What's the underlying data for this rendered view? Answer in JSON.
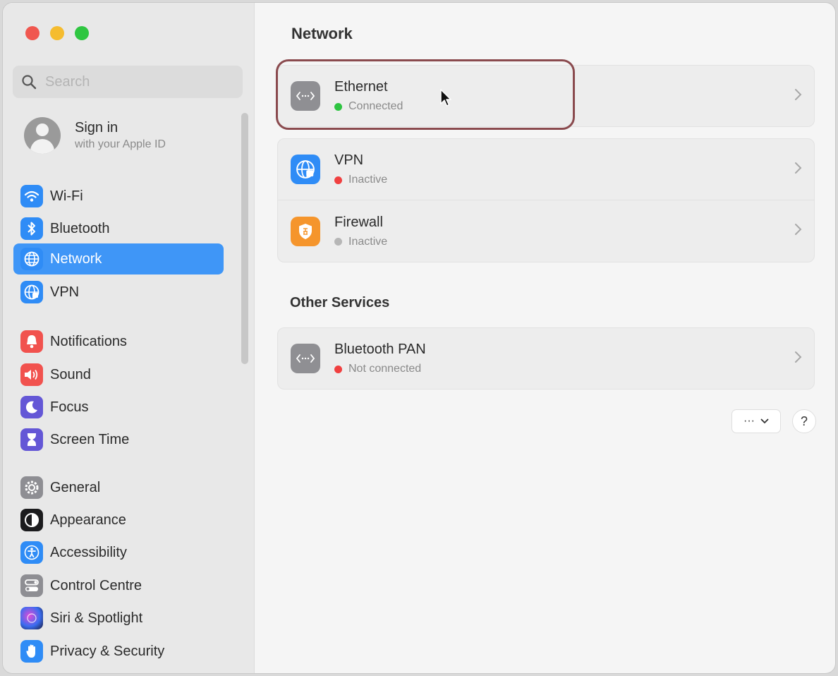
{
  "search": {
    "placeholder": "Search"
  },
  "account": {
    "title": "Sign in",
    "subtitle": "with your Apple ID"
  },
  "sidebar": {
    "items": [
      {
        "label": "Wi-Fi",
        "icon": "wifi-icon",
        "color": "#2f8cf6"
      },
      {
        "label": "Bluetooth",
        "icon": "bluetooth-icon",
        "color": "#2f8cf6"
      },
      {
        "label": "Network",
        "icon": "globe-icon",
        "color": "#2f8cf6",
        "selected": true
      },
      {
        "label": "VPN",
        "icon": "vpn-globe-icon",
        "color": "#2f8cf6"
      },
      {
        "label": "Notifications",
        "icon": "bell-icon",
        "color": "#f1524e"
      },
      {
        "label": "Sound",
        "icon": "speaker-icon",
        "color": "#f1524e"
      },
      {
        "label": "Focus",
        "icon": "moon-icon",
        "color": "#6457d6"
      },
      {
        "label": "Screen Time",
        "icon": "hourglass-icon",
        "color": "#6457d6"
      },
      {
        "label": "General",
        "icon": "gear-icon",
        "color": "#8e8e93"
      },
      {
        "label": "Appearance",
        "icon": "appearance-icon",
        "color": "#1c1c1e"
      },
      {
        "label": "Accessibility",
        "icon": "accessibility-icon",
        "color": "#2f8cf6"
      },
      {
        "label": "Control Centre",
        "icon": "control-centre-icon",
        "color": "#8e8e93"
      },
      {
        "label": "Siri & Spotlight",
        "icon": "siri-icon",
        "color": "#3c3c8c"
      },
      {
        "label": "Privacy & Security",
        "icon": "hand-icon",
        "color": "#2f8cf6"
      }
    ]
  },
  "main": {
    "title": "Network",
    "services": [
      {
        "name": "Ethernet",
        "status": "Connected",
        "status_color": "#2ec441",
        "icon": "ethernet-icon"
      },
      {
        "name": "VPN",
        "status": "Inactive",
        "status_color": "#f04040",
        "icon": "vpn-globe-icon"
      },
      {
        "name": "Firewall",
        "status": "Inactive",
        "status_color": "#b6b6b6",
        "icon": "firewall-icon"
      }
    ],
    "other_services_title": "Other Services",
    "other_services": [
      {
        "name": "Bluetooth PAN",
        "status": "Not connected",
        "status_color": "#f04040",
        "icon": "ethernet-icon"
      }
    ],
    "more_button": "···",
    "help_button": "?"
  }
}
